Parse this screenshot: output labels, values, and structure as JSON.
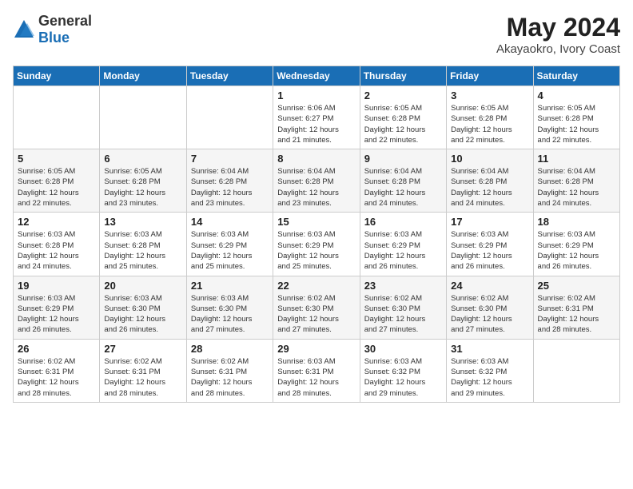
{
  "header": {
    "logo_general": "General",
    "logo_blue": "Blue",
    "month_year": "May 2024",
    "location": "Akayaokro, Ivory Coast"
  },
  "weekdays": [
    "Sunday",
    "Monday",
    "Tuesday",
    "Wednesday",
    "Thursday",
    "Friday",
    "Saturday"
  ],
  "weeks": [
    [
      {
        "day": "",
        "info": ""
      },
      {
        "day": "",
        "info": ""
      },
      {
        "day": "",
        "info": ""
      },
      {
        "day": "1",
        "info": "Sunrise: 6:06 AM\nSunset: 6:27 PM\nDaylight: 12 hours\nand 21 minutes."
      },
      {
        "day": "2",
        "info": "Sunrise: 6:05 AM\nSunset: 6:28 PM\nDaylight: 12 hours\nand 22 minutes."
      },
      {
        "day": "3",
        "info": "Sunrise: 6:05 AM\nSunset: 6:28 PM\nDaylight: 12 hours\nand 22 minutes."
      },
      {
        "day": "4",
        "info": "Sunrise: 6:05 AM\nSunset: 6:28 PM\nDaylight: 12 hours\nand 22 minutes."
      }
    ],
    [
      {
        "day": "5",
        "info": "Sunrise: 6:05 AM\nSunset: 6:28 PM\nDaylight: 12 hours\nand 22 minutes."
      },
      {
        "day": "6",
        "info": "Sunrise: 6:05 AM\nSunset: 6:28 PM\nDaylight: 12 hours\nand 23 minutes."
      },
      {
        "day": "7",
        "info": "Sunrise: 6:04 AM\nSunset: 6:28 PM\nDaylight: 12 hours\nand 23 minutes."
      },
      {
        "day": "8",
        "info": "Sunrise: 6:04 AM\nSunset: 6:28 PM\nDaylight: 12 hours\nand 23 minutes."
      },
      {
        "day": "9",
        "info": "Sunrise: 6:04 AM\nSunset: 6:28 PM\nDaylight: 12 hours\nand 24 minutes."
      },
      {
        "day": "10",
        "info": "Sunrise: 6:04 AM\nSunset: 6:28 PM\nDaylight: 12 hours\nand 24 minutes."
      },
      {
        "day": "11",
        "info": "Sunrise: 6:04 AM\nSunset: 6:28 PM\nDaylight: 12 hours\nand 24 minutes."
      }
    ],
    [
      {
        "day": "12",
        "info": "Sunrise: 6:03 AM\nSunset: 6:28 PM\nDaylight: 12 hours\nand 24 minutes."
      },
      {
        "day": "13",
        "info": "Sunrise: 6:03 AM\nSunset: 6:28 PM\nDaylight: 12 hours\nand 25 minutes."
      },
      {
        "day": "14",
        "info": "Sunrise: 6:03 AM\nSunset: 6:29 PM\nDaylight: 12 hours\nand 25 minutes."
      },
      {
        "day": "15",
        "info": "Sunrise: 6:03 AM\nSunset: 6:29 PM\nDaylight: 12 hours\nand 25 minutes."
      },
      {
        "day": "16",
        "info": "Sunrise: 6:03 AM\nSunset: 6:29 PM\nDaylight: 12 hours\nand 26 minutes."
      },
      {
        "day": "17",
        "info": "Sunrise: 6:03 AM\nSunset: 6:29 PM\nDaylight: 12 hours\nand 26 minutes."
      },
      {
        "day": "18",
        "info": "Sunrise: 6:03 AM\nSunset: 6:29 PM\nDaylight: 12 hours\nand 26 minutes."
      }
    ],
    [
      {
        "day": "19",
        "info": "Sunrise: 6:03 AM\nSunset: 6:29 PM\nDaylight: 12 hours\nand 26 minutes."
      },
      {
        "day": "20",
        "info": "Sunrise: 6:03 AM\nSunset: 6:30 PM\nDaylight: 12 hours\nand 26 minutes."
      },
      {
        "day": "21",
        "info": "Sunrise: 6:03 AM\nSunset: 6:30 PM\nDaylight: 12 hours\nand 27 minutes."
      },
      {
        "day": "22",
        "info": "Sunrise: 6:02 AM\nSunset: 6:30 PM\nDaylight: 12 hours\nand 27 minutes."
      },
      {
        "day": "23",
        "info": "Sunrise: 6:02 AM\nSunset: 6:30 PM\nDaylight: 12 hours\nand 27 minutes."
      },
      {
        "day": "24",
        "info": "Sunrise: 6:02 AM\nSunset: 6:30 PM\nDaylight: 12 hours\nand 27 minutes."
      },
      {
        "day": "25",
        "info": "Sunrise: 6:02 AM\nSunset: 6:31 PM\nDaylight: 12 hours\nand 28 minutes."
      }
    ],
    [
      {
        "day": "26",
        "info": "Sunrise: 6:02 AM\nSunset: 6:31 PM\nDaylight: 12 hours\nand 28 minutes."
      },
      {
        "day": "27",
        "info": "Sunrise: 6:02 AM\nSunset: 6:31 PM\nDaylight: 12 hours\nand 28 minutes."
      },
      {
        "day": "28",
        "info": "Sunrise: 6:02 AM\nSunset: 6:31 PM\nDaylight: 12 hours\nand 28 minutes."
      },
      {
        "day": "29",
        "info": "Sunrise: 6:03 AM\nSunset: 6:31 PM\nDaylight: 12 hours\nand 28 minutes."
      },
      {
        "day": "30",
        "info": "Sunrise: 6:03 AM\nSunset: 6:32 PM\nDaylight: 12 hours\nand 29 minutes."
      },
      {
        "day": "31",
        "info": "Sunrise: 6:03 AM\nSunset: 6:32 PM\nDaylight: 12 hours\nand 29 minutes."
      },
      {
        "day": "",
        "info": ""
      }
    ]
  ],
  "accent_color": "#1a6eb5"
}
